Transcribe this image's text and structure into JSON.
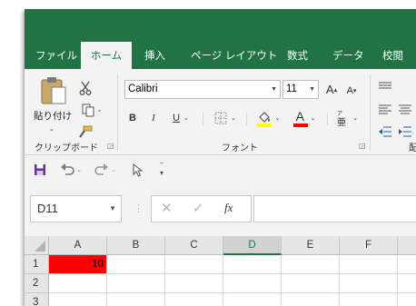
{
  "colors": {
    "brand_green": "#217346",
    "cell_a1_fill": "#ff0000",
    "save_icon": "#6b2fa0"
  },
  "ribbon_tabs": [
    {
      "label": "ファイル"
    },
    {
      "label": "ホーム",
      "active": true
    },
    {
      "label": "挿入"
    },
    {
      "label": "ページ レイアウト"
    },
    {
      "label": "数式"
    },
    {
      "label": "データ"
    },
    {
      "label": "校閲"
    }
  ],
  "clipboard": {
    "paste_label": "貼り付け",
    "group_label": "クリップボード"
  },
  "font": {
    "font_name": "Calibri",
    "font_size": "11",
    "grow_label": "A",
    "shrink_label": "A",
    "bold_label": "B",
    "italic_label": "I",
    "underline_label": "U",
    "font_color_label": "A",
    "group_label": "フォント"
  },
  "alignment": {
    "group_label_partial": "配"
  },
  "formula_bar": {
    "name_box_value": "D11",
    "fx_label": "fx"
  },
  "sheet": {
    "columns": [
      "A",
      "B",
      "C",
      "D",
      "E",
      "F"
    ],
    "selected_column": "D",
    "rows": [
      "1",
      "2",
      "3"
    ],
    "cells": {
      "A1": "10"
    }
  },
  "icons": [
    "paste-icon",
    "cut-icon",
    "copy-icon",
    "format-painter-icon",
    "border-icon",
    "fill-color-icon",
    "font-color-icon",
    "phonetic-icon",
    "save-icon",
    "undo-icon",
    "redo-icon",
    "pointer-icon",
    "customize-icon",
    "cancel-icon",
    "enter-icon",
    "align-icon"
  ]
}
